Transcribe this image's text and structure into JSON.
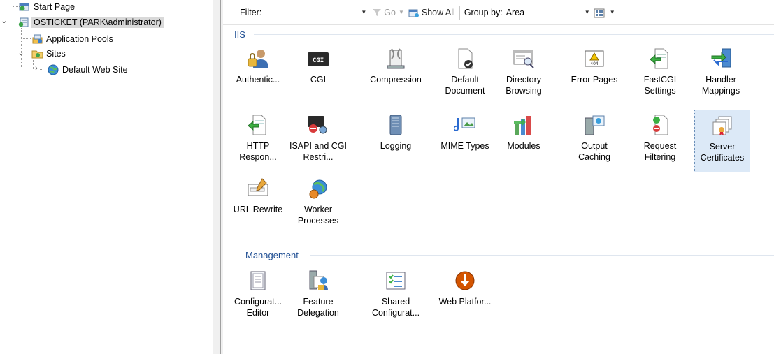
{
  "tree": {
    "items": [
      {
        "label": "Start Page",
        "icon": "start-page-icon"
      },
      {
        "label": "OSTICKET (PARK\\administrator)",
        "icon": "server-icon",
        "expanded": true,
        "selected": true
      },
      {
        "label": "Application Pools",
        "icon": "application-pools-icon"
      },
      {
        "label": "Sites",
        "icon": "sites-folder-icon",
        "expanded": true
      },
      {
        "label": "Default Web Site",
        "icon": "globe-icon",
        "expanded": false
      }
    ]
  },
  "filterbar": {
    "filter_label": "Filter:",
    "filter_value": "",
    "go_label": "Go",
    "show_all_label": "Show All",
    "group_by_label": "Group by:",
    "group_by_value": "Area"
  },
  "groups": [
    {
      "title": "IIS",
      "features": [
        {
          "label": "Authentic...",
          "icon": "authentication-icon"
        },
        {
          "label": "CGI",
          "icon": "cgi-icon"
        },
        {
          "label": "Compression",
          "icon": "compression-icon"
        },
        {
          "label": "Default Document",
          "icon": "default-document-icon"
        },
        {
          "label": "Directory Browsing",
          "icon": "directory-browsing-icon"
        },
        {
          "label": "Error Pages",
          "icon": "error-pages-icon"
        },
        {
          "label": "FastCGI Settings",
          "icon": "fastcgi-settings-icon"
        },
        {
          "label": "Handler Mappings",
          "icon": "handler-mappings-icon"
        },
        {
          "label": "HTTP Respon...",
          "icon": "http-response-headers-icon"
        },
        {
          "label": "ISAPI and CGI Restri...",
          "icon": "isapi-cgi-restrictions-icon"
        },
        {
          "label": "Logging",
          "icon": "logging-icon"
        },
        {
          "label": "MIME Types",
          "icon": "mime-types-icon"
        },
        {
          "label": "Modules",
          "icon": "modules-icon"
        },
        {
          "label": "Output Caching",
          "icon": "output-caching-icon"
        },
        {
          "label": "Request Filtering",
          "icon": "request-filtering-icon"
        },
        {
          "label": "Server Certificates",
          "icon": "server-certificates-icon",
          "selected": true
        },
        {
          "label": "URL Rewrite",
          "icon": "url-rewrite-icon"
        },
        {
          "label": "Worker Processes",
          "icon": "worker-processes-icon"
        }
      ]
    },
    {
      "title": "Management",
      "features": [
        {
          "label": "Configurat... Editor",
          "icon": "configuration-editor-icon"
        },
        {
          "label": "Feature Delegation",
          "icon": "feature-delegation-icon"
        },
        {
          "label": "Shared Configurat...",
          "icon": "shared-configuration-icon"
        },
        {
          "label": "Web Platfor...",
          "icon": "web-platform-installer-icon"
        }
      ]
    }
  ]
}
